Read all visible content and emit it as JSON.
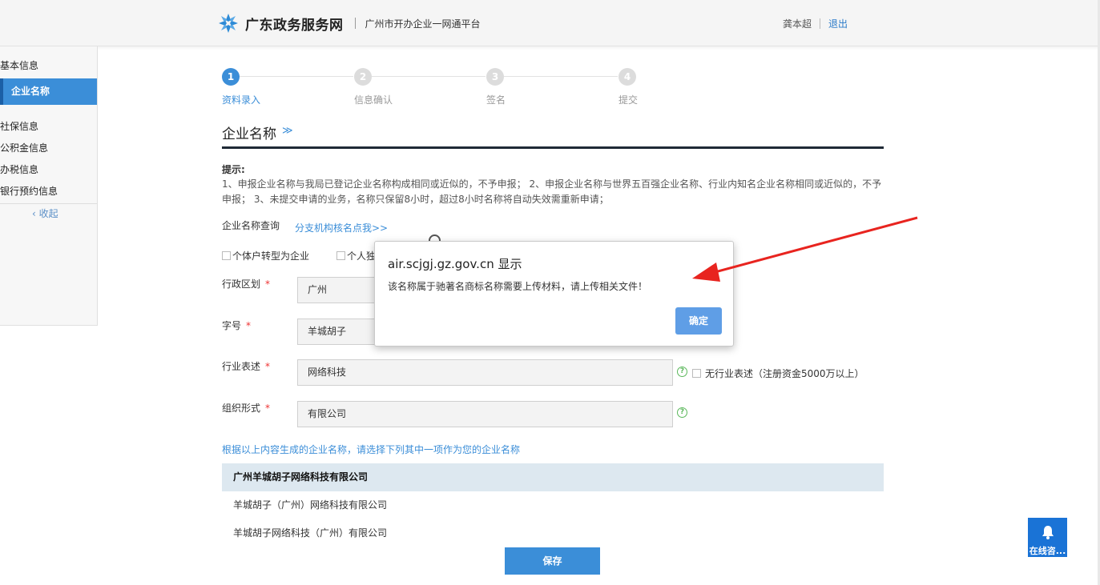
{
  "header": {
    "brand_name": "广东政务服务网",
    "platform": "广州市开办企业一网通平台",
    "user_name": "龚本超",
    "logout": "退出"
  },
  "sidebar": {
    "items": [
      {
        "label": "基本信息"
      },
      {
        "label": "企业名称",
        "active": true
      },
      {
        "label": "社保信息"
      },
      {
        "label": "公积金信息"
      },
      {
        "label": "办税信息"
      },
      {
        "label": "银行预约信息"
      }
    ],
    "collapse": "收起"
  },
  "steps": [
    {
      "number": "1",
      "label": "资料录入",
      "active": true
    },
    {
      "number": "2",
      "label": "信息确认"
    },
    {
      "number": "3",
      "label": "签名"
    },
    {
      "number": "4",
      "label": "提交"
    }
  ],
  "section": {
    "title": "企业名称",
    "tip_title": "提示:",
    "tip_text": "1、申报企业名称与我局已登记企业名称构成相同或近似的，不予申报； 2、申报企业名称与世界五百强企业名称、行业内知名企业名称相同或近似的，不予申报； 3、未提交申请的业务，名称只保留8小时，超过8小时名称将自动失效需重新申请；"
  },
  "query": {
    "label": "企业名称查询",
    "branch_link": "分支机构核名点我>>"
  },
  "checkboxes": {
    "transform": "个体户转型为企业",
    "sole": "个人独"
  },
  "form": {
    "region_label": "行政区划",
    "region_value": "广州",
    "brand_label": "字号",
    "brand_value": "羊城胡子",
    "industry_label": "行业表述",
    "industry_value": "网络科技",
    "no_industry": "无行业表述（注册资金5000万以上）",
    "org_label": "组织形式",
    "org_value": "有限公司",
    "required_mark": "*"
  },
  "generated": {
    "hint": "根据以上内容生成的企业名称，请选择下列其中一项作为您的企业名称",
    "names": [
      {
        "label": "广州羊城胡子网络科技有限公司",
        "selected": true
      },
      {
        "label": "羊城胡子（广州）网络科技有限公司"
      },
      {
        "label": "羊城胡子网络科技（广州）有限公司"
      }
    ]
  },
  "save_button": "保存",
  "chat": {
    "label": "在线咨..."
  },
  "dialog": {
    "title": "air.scjgj.gz.gov.cn 显示",
    "message": "该名称属于驰著名商标名称需要上传材料，请上传相关文件！",
    "ok": "确定"
  },
  "colors": {
    "accent": "#3b8ed8",
    "header_bg": "#f5f5f5",
    "arrow": "#e8241f"
  }
}
